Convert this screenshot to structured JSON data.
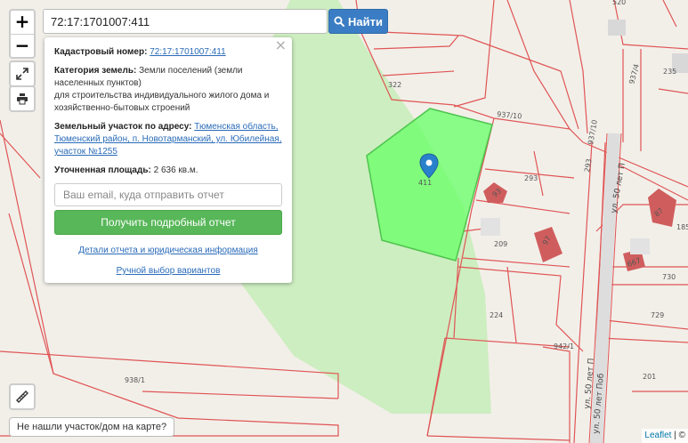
{
  "search": {
    "value": "72:17:1701007:411",
    "button_label": "Найти"
  },
  "controls": {
    "zoom_in": "+",
    "zoom_out": "−"
  },
  "panel": {
    "close": "×",
    "cadastral_label": "Кадастровый номер:",
    "cadastral_value": "72:17:1701007:411",
    "category_label": "Категория земель:",
    "category_value": "Земли поселений (земли населенных пунктов)",
    "usage_value": "для строительства индивидуального жилого дома и хозяйственно-бытовых строений",
    "address_label": "Земельный участок по адресу:",
    "address_value": "Тюменская область, Тюменский район, п. Новотарманский, ул. Юбилейная, участок №1255",
    "area_label": "Уточненная площадь:",
    "area_value": "2 636 кв.м.",
    "email_placeholder": "Ваш email, куда отправить отчет",
    "report_button": "Получить подробный отчет",
    "details_link": "Детали отчета и юридическая информация",
    "manual_link": "Ручной выбор вариантов"
  },
  "not_found_button": "Не нашли участок/дом на карте?",
  "attribution": {
    "leaflet": "Leaflet",
    "separator": "|",
    "copyright": "©"
  },
  "map": {
    "marker_label": "411",
    "parcels": [
      "520",
      "322",
      "235",
      "937/10",
      "937/10",
      "293",
      "293",
      "937/4",
      "209",
      "185",
      "224",
      "730",
      "729",
      "942/1",
      "938/1",
      "201"
    ],
    "house_numbers": [
      "93",
      "97",
      "87",
      "667"
    ],
    "streets": [
      "ул. 50 лет П",
      "ул. 50 лет П",
      "ул. 50 лет Поб"
    ],
    "colors": {
      "selected_parcel": "#66ff66",
      "parcel_border": "#e05555",
      "forest": "#cdeec0",
      "marker": "#2a81cb",
      "building": "#d05d5d"
    }
  }
}
